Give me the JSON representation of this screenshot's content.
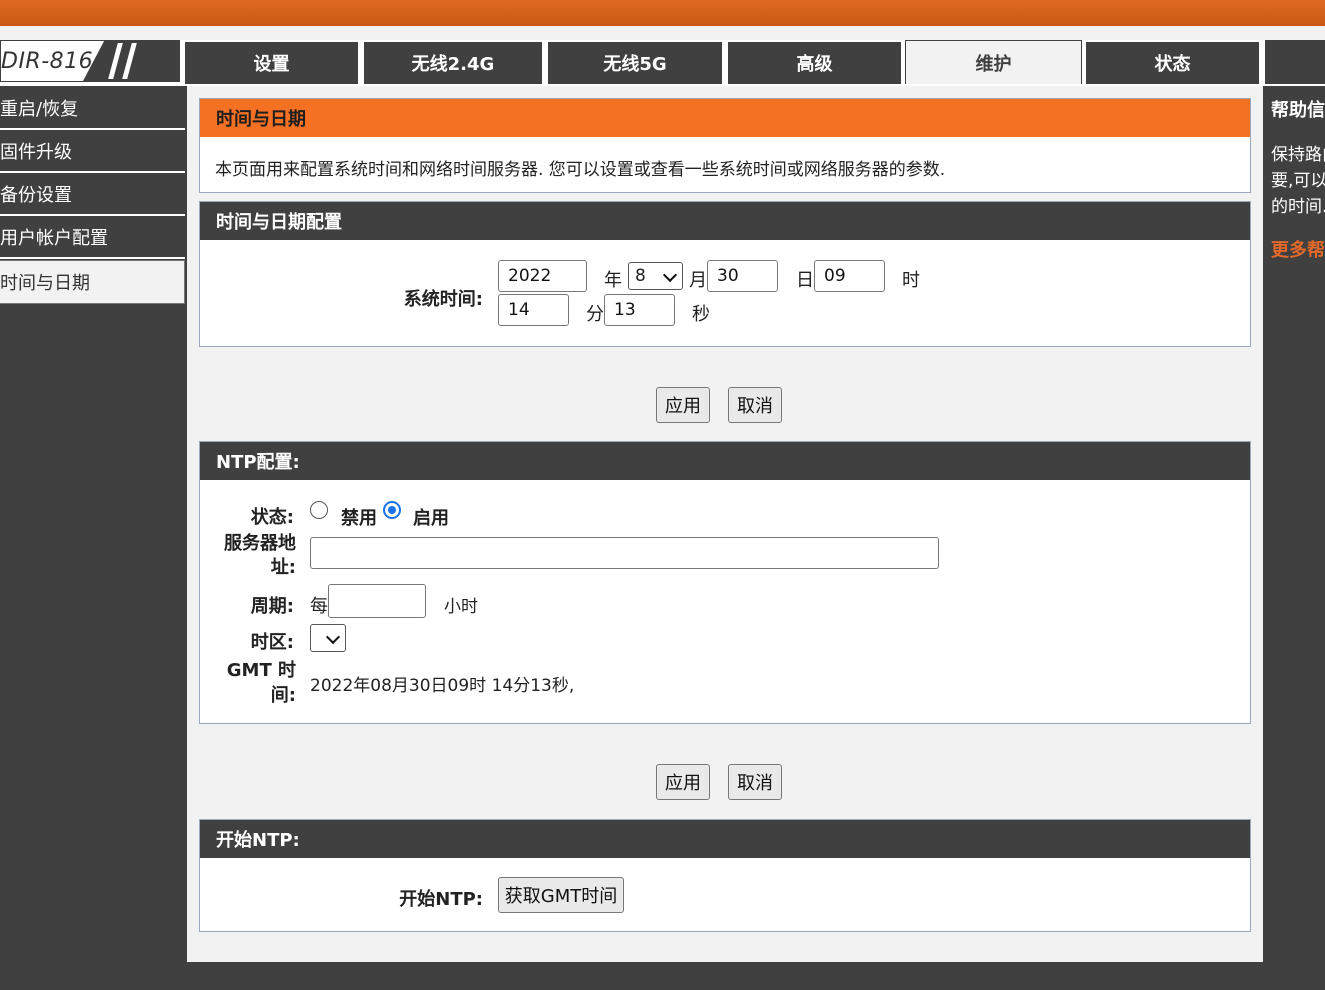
{
  "brand": {
    "model": "DIR-816"
  },
  "tabs": [
    {
      "label": "设置"
    },
    {
      "label": "无线2.4G"
    },
    {
      "label": "无线5G"
    },
    {
      "label": "高级"
    },
    {
      "label": "维护",
      "active": true
    },
    {
      "label": "状态"
    }
  ],
  "sidebar": {
    "items": [
      {
        "label": "重启/恢复"
      },
      {
        "label": "固件升级"
      },
      {
        "label": "备份设置"
      },
      {
        "label": "用户帐户配置"
      },
      {
        "label": "时间与日期",
        "active": true
      }
    ]
  },
  "intro": {
    "title": "时间与日期",
    "description": "本页面用来配置系统时间和网络时间服务器. 您可以设置或查看一些系统时间或网络服务器的参数."
  },
  "time_config": {
    "title": "时间与日期配置",
    "label": "系统时间:",
    "year": "2022",
    "year_unit": "年",
    "month": "8",
    "month_unit": "月",
    "day": "30",
    "day_unit": "日",
    "hour": "09",
    "hour_unit": "时",
    "minute": "14",
    "minute_unit": "分",
    "second": "13",
    "second_unit": "秒",
    "apply": "应用",
    "cancel": "取消"
  },
  "ntp_config": {
    "title": "NTP配置:",
    "status_label": "状态:",
    "disabled_label": "禁用",
    "enabled_label": "启用",
    "status_value": "启用",
    "server_label": "服务器地址:",
    "server_value": "",
    "period_label": "周期:",
    "period_prefix": "每",
    "period_value": "",
    "period_unit": "小时",
    "timezone_label": "时区:",
    "timezone_value": "",
    "gmt_label": "GMT 时间:",
    "gmt_value": "2022年08月30日09时 14分13秒,",
    "apply": "应用",
    "cancel": "取消"
  },
  "start_ntp": {
    "title": "开始NTP:",
    "label": "开始NTP:",
    "button": "获取GMT时间"
  },
  "help": {
    "title": "帮助信息",
    "text": "保持路由器时间准确很重要,可以让日志记录更精确的时间.",
    "more": "更多帮助"
  },
  "colors": {
    "accent": "#f47023",
    "dark": "#404040",
    "panel": "#f2f2f2"
  }
}
